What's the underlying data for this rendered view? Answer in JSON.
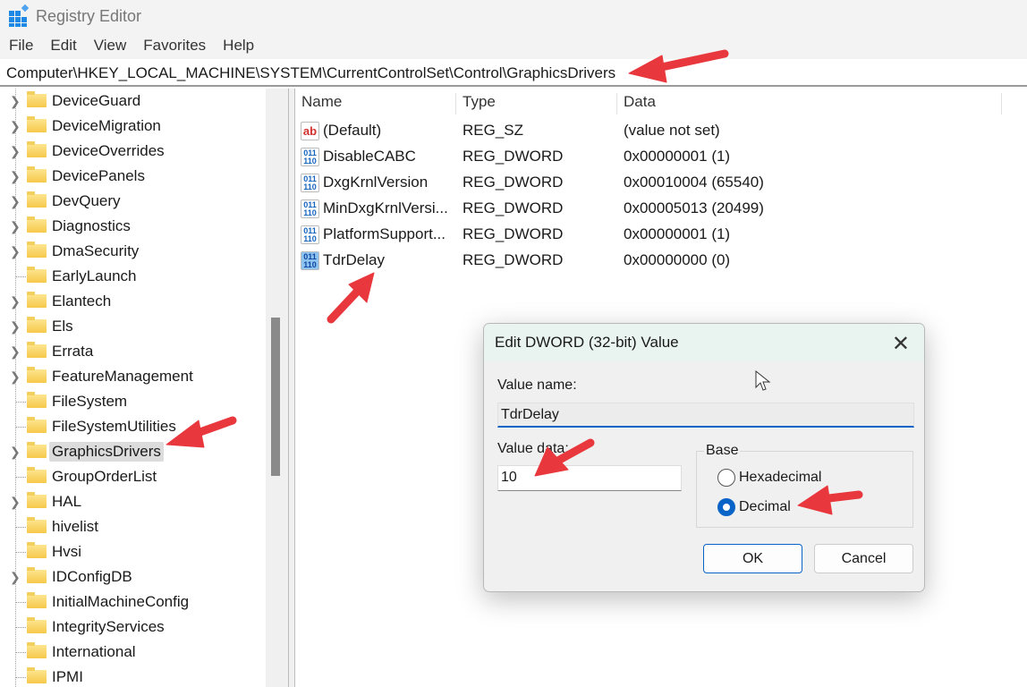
{
  "window": {
    "title": "Registry Editor"
  },
  "menu": [
    "File",
    "Edit",
    "View",
    "Favorites",
    "Help"
  ],
  "address": "Computer\\HKEY_LOCAL_MACHINE\\SYSTEM\\CurrentControlSet\\Control\\GraphicsDrivers",
  "tree": [
    {
      "label": "DeviceGuard",
      "expandable": true
    },
    {
      "label": "DeviceMigration",
      "expandable": true
    },
    {
      "label": "DeviceOverrides",
      "expandable": true
    },
    {
      "label": "DevicePanels",
      "expandable": true
    },
    {
      "label": "DevQuery",
      "expandable": true
    },
    {
      "label": "Diagnostics",
      "expandable": true
    },
    {
      "label": "DmaSecurity",
      "expandable": true
    },
    {
      "label": "EarlyLaunch",
      "expandable": false
    },
    {
      "label": "Elantech",
      "expandable": true
    },
    {
      "label": "Els",
      "expandable": true
    },
    {
      "label": "Errata",
      "expandable": true
    },
    {
      "label": "FeatureManagement",
      "expandable": true
    },
    {
      "label": "FileSystem",
      "expandable": false
    },
    {
      "label": "FileSystemUtilities",
      "expandable": false
    },
    {
      "label": "GraphicsDrivers",
      "expandable": true,
      "selected": true
    },
    {
      "label": "GroupOrderList",
      "expandable": false
    },
    {
      "label": "HAL",
      "expandable": true
    },
    {
      "label": "hivelist",
      "expandable": false
    },
    {
      "label": "Hvsi",
      "expandable": false
    },
    {
      "label": "IDConfigDB",
      "expandable": true
    },
    {
      "label": "InitialMachineConfig",
      "expandable": false
    },
    {
      "label": "IntegrityServices",
      "expandable": false
    },
    {
      "label": "International",
      "expandable": false
    },
    {
      "label": "IPMI",
      "expandable": false
    }
  ],
  "columns": {
    "name": "Name",
    "type": "Type",
    "data": "Data"
  },
  "values": [
    {
      "name": "(Default)",
      "type": "REG_SZ",
      "data": "(value not set)",
      "icon": "string-value-icon"
    },
    {
      "name": "DisableCABC",
      "type": "REG_DWORD",
      "data": "0x00000001 (1)",
      "icon": "binary-value-icon"
    },
    {
      "name": "DxgKrnlVersion",
      "type": "REG_DWORD",
      "data": "0x00010004 (65540)",
      "icon": "binary-value-icon"
    },
    {
      "name": "MinDxgKrnlVersi...",
      "type": "REG_DWORD",
      "data": "0x00005013 (20499)",
      "icon": "binary-value-icon"
    },
    {
      "name": "PlatformSupport...",
      "type": "REG_DWORD",
      "data": "0x00000001 (1)",
      "icon": "binary-value-icon"
    },
    {
      "name": "TdrDelay",
      "type": "REG_DWORD",
      "data": "0x00000000 (0)",
      "icon": "binary-value-icon",
      "selected": true
    }
  ],
  "dialog": {
    "title": "Edit DWORD (32-bit) Value",
    "value_name_label": "Value name:",
    "value_name": "TdrDelay",
    "value_data_label": "Value data:",
    "value_data": "10",
    "base_label": "Base",
    "hex_label": "Hexadecimal",
    "dec_label": "Decimal",
    "selected_base": "Decimal",
    "ok": "OK",
    "cancel": "Cancel"
  },
  "colors": {
    "accent": "#0a64c8",
    "annotation_arrow": "#e8383d"
  }
}
